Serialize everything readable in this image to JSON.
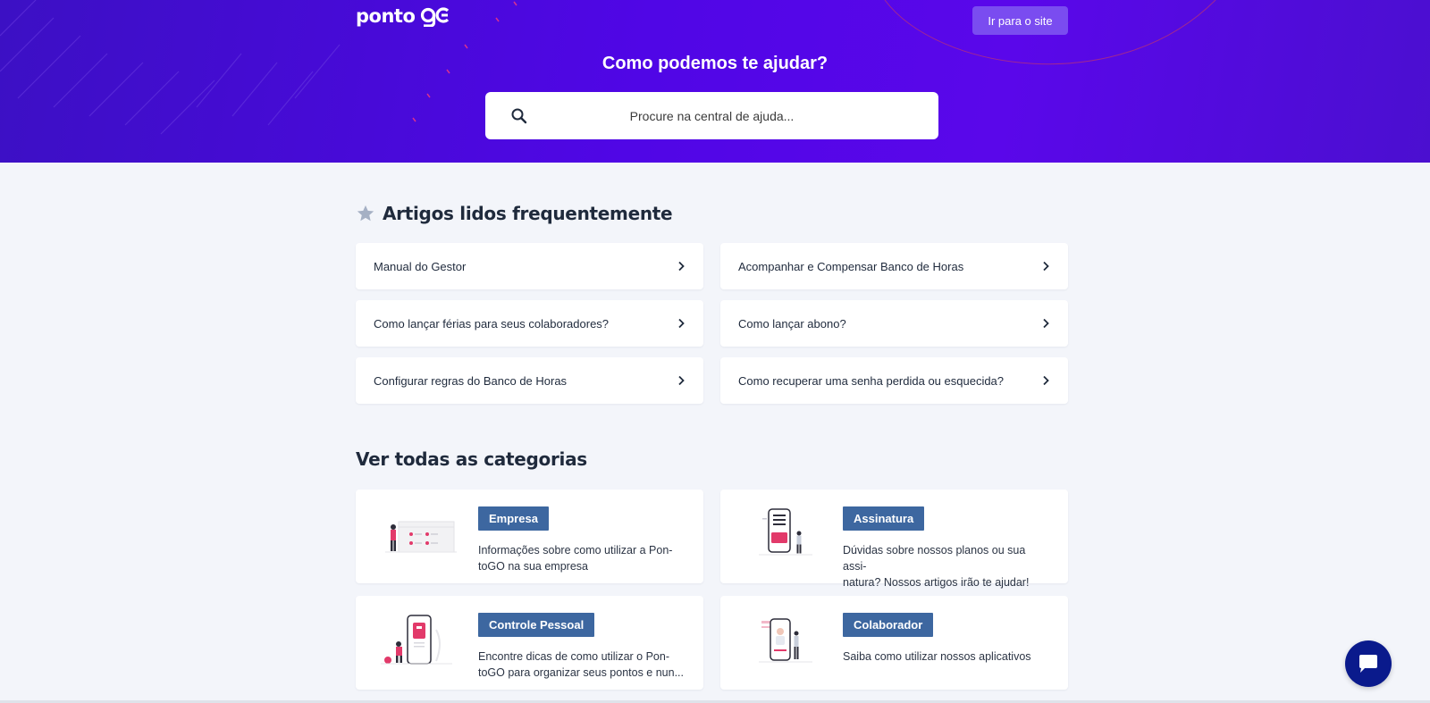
{
  "header": {
    "logo_text": "ponto",
    "site_button_label": "Ir para o site",
    "title": "Como podemos te ajudar?",
    "search": {
      "placeholder": "Procure na central de ajuda..."
    }
  },
  "frequent": {
    "title": "Artigos lidos frequentemente",
    "articles": [
      "Manual do Gestor",
      "Acompanhar e Compensar Banco de Horas",
      "Como lançar férias para seus colaboradores?",
      "Como lançar abono?",
      "Configurar regras do Banco de Horas",
      "Como recuperar uma senha perdida ou esquecida?"
    ]
  },
  "categories": {
    "title": "Ver todas as categorias",
    "items": [
      {
        "name": "Empresa",
        "desc_1": "Informações sobre como utilizar a Pon-",
        "desc_2": "toGO na sua empresa"
      },
      {
        "name": "Assinatura",
        "desc_1": "Dúvidas sobre nossos planos ou sua assi-",
        "desc_2": "natura? Nossos artigos irão te ajudar!"
      },
      {
        "name": "Controle Pessoal",
        "desc_1": "Encontre dicas de como utilizar o Pon-",
        "desc_2": "toGO para organizar seus pontos e nun..."
      },
      {
        "name": "Colaborador",
        "desc_1": "Saiba como utilizar nossos aplicativos",
        "desc_2": ""
      }
    ]
  },
  "colors": {
    "hero_gradient_start": "#3c10c4",
    "hero_gradient_end": "#5a07ea",
    "site_button": "#7a4cf0",
    "category_tag": "#3d67a0",
    "chat_button": "#0a1a8c",
    "page_bg": "#f3f5fa"
  },
  "icons": [
    "search-icon",
    "star-icon",
    "chevron-right-icon",
    "chat-icon"
  ]
}
